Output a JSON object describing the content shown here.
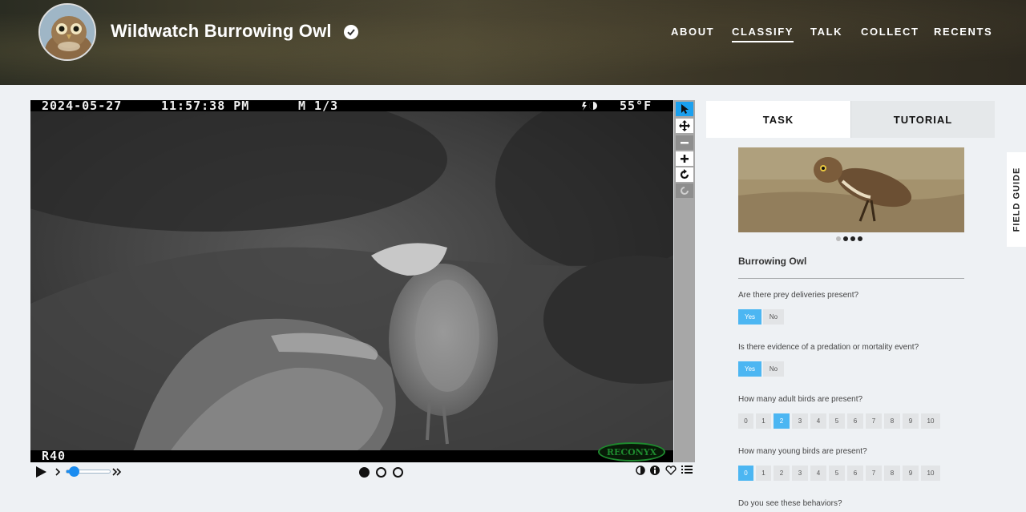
{
  "header": {
    "project_title": "Wildwatch Burrowing Owl",
    "nav": [
      "ABOUT",
      "CLASSIFY",
      "TALK",
      "COLLECT",
      "RECENTS"
    ],
    "active_nav": "CLASSIFY"
  },
  "viewer": {
    "osd_date": "2024-05-27",
    "osd_time": "11:57:38 PM",
    "osd_mode": "M 1/3",
    "osd_temp": "55°F",
    "camera_label": "R40",
    "watermark": "RECONYX",
    "tools": [
      "pointer-icon",
      "pan-icon",
      "zoom-out-icon",
      "zoom-in-icon",
      "rotate-icon",
      "reset-icon"
    ],
    "frames": 3,
    "current_frame": 1
  },
  "panel": {
    "tabs": [
      "TASK",
      "TUTORIAL"
    ],
    "field_guide": "FIELD GUIDE",
    "species_heading": "Burrowing Owl",
    "questions": [
      {
        "text": "Are there prey deliveries present?",
        "options": [
          "Yes",
          "No"
        ],
        "selected": "Yes"
      },
      {
        "text": "Is there evidence of a predation or mortality event?",
        "options": [
          "Yes",
          "No"
        ],
        "selected": "Yes"
      },
      {
        "text": "How many adult birds are present?",
        "options": [
          "0",
          "1",
          "2",
          "3",
          "4",
          "5",
          "6",
          "7",
          "8",
          "9",
          "10"
        ],
        "selected": "2"
      },
      {
        "text": "How many young birds are present?",
        "options": [
          "0",
          "1",
          "2",
          "3",
          "4",
          "5",
          "6",
          "7",
          "8",
          "9",
          "10"
        ],
        "selected": "0"
      },
      {
        "text": "Do you see these behaviors?",
        "options": [],
        "selected": ""
      }
    ]
  },
  "colors": {
    "accent_selected": "#4cb6f2",
    "tool_active": "#1aa0ef",
    "watermark_green": "#1e8a2e"
  }
}
